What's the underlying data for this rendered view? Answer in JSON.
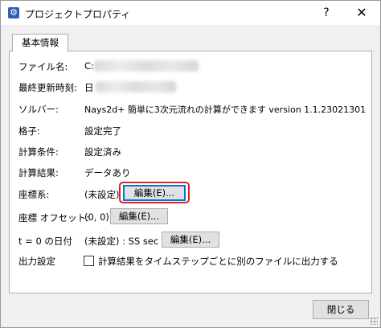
{
  "window": {
    "title": "プロジェクトプロパティ",
    "help_label": "?",
    "close_label": "✕"
  },
  "tabs": [
    {
      "label": "基本情報",
      "selected": true
    }
  ],
  "fields": {
    "filename": {
      "label": "ファイル名:",
      "value": "C:"
    },
    "modified": {
      "label": "最終更新時刻:",
      "value": "日"
    },
    "solver": {
      "label": "ソルバー:",
      "value": "Nays2d+ 簡単に3次元流れの計算ができます version 1.1.23021301"
    },
    "grid": {
      "label": "格子:",
      "value": "設定完了"
    },
    "calc_cond": {
      "label": "計算条件:",
      "value": "設定済み"
    },
    "calc_result": {
      "label": "計算結果:",
      "value": "データあり"
    },
    "coord": {
      "label": "座標系:",
      "value": "(未設定)",
      "button": "編集(E)..."
    },
    "coord_offset": {
      "label": "座標 オフセット:",
      "value": "(0, 0)",
      "button": "編集(E)..."
    },
    "t0_date": {
      "label": "t = 0 の日付",
      "value": "(未設定) : SS sec",
      "button": "編集(E)..."
    },
    "output": {
      "label": "出力設定",
      "checkbox_label": "計算結果をタイムステップごとに別のファイルに出力する",
      "checked": false
    }
  },
  "footer": {
    "close_button": "閉じる"
  },
  "colors": {
    "highlight": "#e0201b",
    "focus": "#0078d7"
  }
}
